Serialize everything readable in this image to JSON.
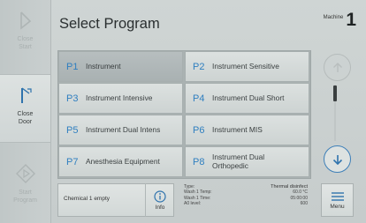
{
  "sidebar": {
    "items": [
      {
        "label": "Close\nStart",
        "icon": "door-open-icon",
        "state": "disabled"
      },
      {
        "label": "Close\nDoor",
        "icon": "door-close-icon",
        "state": "active"
      },
      {
        "label": "Start\nProgram",
        "icon": "start-diamond-icon",
        "state": "disabled"
      }
    ]
  },
  "header": {
    "title": "Select Program",
    "machine_label": "Machine",
    "machine_number": "1"
  },
  "programs": [
    {
      "no": "P1",
      "name": "Instrument",
      "selected": true
    },
    {
      "no": "P2",
      "name": "Instrument Sensitive",
      "selected": false
    },
    {
      "no": "P3",
      "name": "Instrument Intensive",
      "selected": false
    },
    {
      "no": "P4",
      "name": "Instrument Dual Short",
      "selected": false
    },
    {
      "no": "P5",
      "name": "Instrument Dual Intens",
      "selected": false
    },
    {
      "no": "P6",
      "name": "Instrument MIS",
      "selected": false
    },
    {
      "no": "P7",
      "name": "Anesthesia Equipment",
      "selected": false
    },
    {
      "no": "P8",
      "name": "Instrument Dual Orthopedic",
      "selected": false
    }
  ],
  "status": {
    "message": "Chemical 1 empty",
    "info_label": "Info"
  },
  "cycle": {
    "labels": [
      "Type:",
      "Wash 1 Temp:",
      "Wash 1 Time:",
      "A0 level:"
    ],
    "values": [
      "Thermal disinfect",
      "60.0 °C",
      "05:00:00",
      "600"
    ]
  },
  "menu": {
    "label": "Menu"
  },
  "colors": {
    "accent": "#2f7fc0",
    "background": "#c8cfcf"
  }
}
